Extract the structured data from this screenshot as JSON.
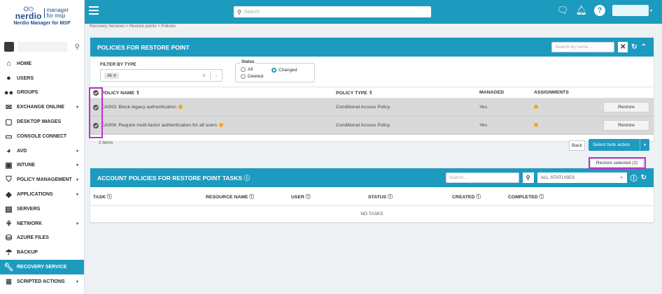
{
  "brand": {
    "logo_word": "nerdio",
    "logo_sub1": "manager",
    "logo_sub2": "for msp",
    "caption": "Nerdio Manager for MSP"
  },
  "topbar": {
    "search_placeholder": "Search"
  },
  "breadcrumb": "Recovery Services  >  Restore points  >  Policies",
  "sidebar": {
    "items": [
      {
        "label": "HOME",
        "icon": "home-icon",
        "caret": false
      },
      {
        "label": "USERS",
        "icon": "user-icon",
        "caret": false
      },
      {
        "label": "GROUPS",
        "icon": "groups-icon",
        "caret": false
      },
      {
        "label": "EXCHANGE ONLINE",
        "icon": "mail-icon",
        "caret": true
      },
      {
        "label": "DESKTOP IMAGES",
        "icon": "desktop-images-icon",
        "caret": false
      },
      {
        "label": "CONSOLE CONNECT",
        "icon": "monitor-icon",
        "caret": false
      },
      {
        "label": "AVD",
        "icon": "avd-icon",
        "caret": true
      },
      {
        "label": "INTUNE",
        "icon": "intune-icon",
        "caret": true
      },
      {
        "label": "POLICY MANAGEMENT",
        "icon": "shield-check-icon",
        "caret": true
      },
      {
        "label": "APPLICATIONS",
        "icon": "package-icon",
        "caret": true
      },
      {
        "label": "SERVERS",
        "icon": "server-icon",
        "caret": false
      },
      {
        "label": "NETWORK",
        "icon": "network-icon",
        "caret": true
      },
      {
        "label": "AZURE FILES",
        "icon": "database-icon",
        "caret": false
      },
      {
        "label": "BACKUP",
        "icon": "umbrella-icon",
        "caret": false
      },
      {
        "label": "RECOVERY SERVICE",
        "icon": "wrench-icon",
        "caret": false,
        "active": true
      },
      {
        "label": "SCRIPTED ACTIONS",
        "icon": "list-icon",
        "caret": true
      }
    ]
  },
  "policies": {
    "title": "POLICIES FOR RESTORE POINT",
    "search_placeholder": "Search by name...",
    "filter_label": "FILTER BY TYPE",
    "filter_tag": "All",
    "status_legend": "Status",
    "status_options": {
      "all": "All",
      "deleted": "Deleted",
      "changed": "Changed"
    },
    "columns": {
      "name": "POLICY NAME ⇧",
      "type": "POLICY TYPE ⇧",
      "managed": "MANAGED",
      "assignments": "ASSIGNMENTS"
    },
    "rows": [
      {
        "name": "CA003: Block legacy authentication",
        "type": "Conditional Access Policy",
        "managed": "Yes",
        "action": "Restore"
      },
      {
        "name": "CA004: Require multi-factor authentication for all users",
        "type": "Conditional Access Policy",
        "managed": "Yes",
        "action": "Restore"
      }
    ],
    "count": "2 items",
    "back": "Back",
    "bulk": "Select bulk action",
    "bulk_menu_item": "Restore selected (2)"
  },
  "tasks": {
    "title": "ACCOUNT POLICIES FOR RESTORE POINT TASKS ⓘ",
    "search_placeholder": "Search...",
    "status_filter": "ALL STATUSES",
    "columns": {
      "task": "TASK ⓘ",
      "resource": "RESOURCE NAME ⓘ",
      "user": "USER ⓘ",
      "status": "STATUS ⓘ",
      "created": "CREATED ⓘ",
      "completed": "COMPLETED ⓘ"
    },
    "empty": "NO TASKS"
  },
  "colors": {
    "accent": "#1d9bbf",
    "highlight": "#b935c6",
    "warning": "#f5a623"
  }
}
